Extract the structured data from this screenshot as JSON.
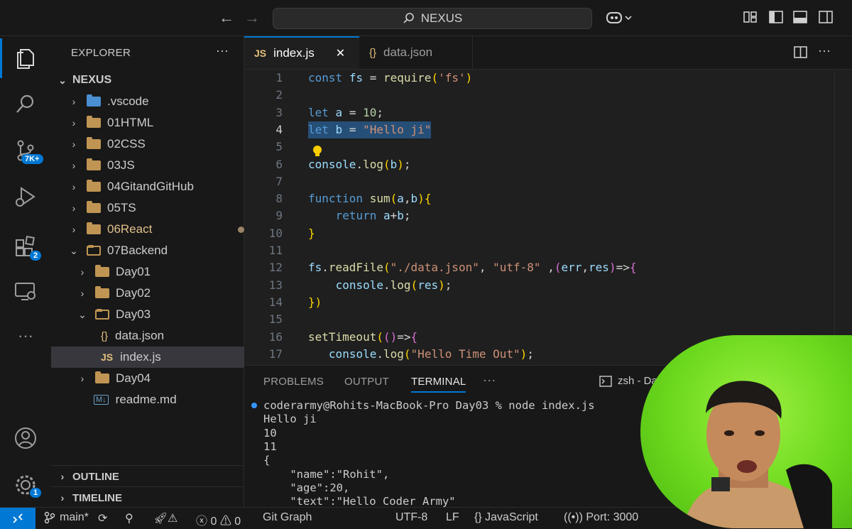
{
  "titlebar": {
    "search_label": "NEXUS",
    "icons": [
      "back-arrow-icon",
      "forward-arrow-icon",
      "search-icon",
      "copilot-icon",
      "customize-layout-icon",
      "toggle-sidebar-icon",
      "toggle-panel-icon",
      "toggle-secondary-sidebar-icon"
    ]
  },
  "activitybar": {
    "items": [
      "explorer-icon",
      "search-icon",
      "source-control-icon",
      "run-debug-icon",
      "extensions-icon",
      "remote-explorer-icon",
      "more-icon",
      "accounts-icon",
      "manage-gear-icon"
    ],
    "source_control_badge": "7K+",
    "extensions_badge": "2",
    "manage_badge": "1"
  },
  "sidebar": {
    "title": "EXPLORER",
    "more": "···",
    "root": "NEXUS",
    "tree": [
      {
        "label": ".vscode"
      },
      {
        "label": "01HTML"
      },
      {
        "label": "02CSS"
      },
      {
        "label": "03JS"
      },
      {
        "label": "04GitandGitHub"
      },
      {
        "label": "05TS"
      },
      {
        "label": "06React"
      },
      {
        "label": "07Backend"
      },
      {
        "label": "Day01"
      },
      {
        "label": "Day02"
      },
      {
        "label": "Day03"
      },
      {
        "label": "data.json"
      },
      {
        "label": "index.js"
      },
      {
        "label": "Day04"
      },
      {
        "label": "readme.md"
      }
    ],
    "outline": "OUTLINE",
    "timeline": "TIMELINE"
  },
  "editor": {
    "tabs": [
      {
        "icon_text": "JS",
        "label": "index.js",
        "close": "✕"
      },
      {
        "icon_text": "{}",
        "label": "data.json"
      }
    ],
    "line_numbers": [
      "1",
      "2",
      "3",
      "4",
      "5",
      "6",
      "7",
      "8",
      "9",
      "10",
      "11",
      "12",
      "13",
      "14",
      "15",
      "16",
      "17"
    ],
    "current_line": 4,
    "lines": [
      "const fs = require('fs')",
      "",
      "let a = 10;",
      "let b = \"Hello ji\"",
      "",
      "console.log(b);",
      "",
      "function sum(a,b){",
      "    return a+b;",
      "}",
      "",
      "fs.readFile(\"./data.json\", \"utf-8\" ,(err,res)=>{",
      "    console.log(res);",
      "})",
      "",
      "setTimeout(()=>{",
      "   console.log(\"Hello Time Out\");"
    ]
  },
  "panel": {
    "tabs": [
      "PROBLEMS",
      "OUTPUT",
      "TERMINAL"
    ],
    "active_tab": "TERMINAL",
    "more": "···",
    "terminal_name": "zsh - Day",
    "terminal_lines": [
      "coderarmy@Rohits-MacBook-Pro Day03 % node index.js",
      "Hello ji",
      "10",
      "11",
      "{",
      "    \"name\":\"Rohit\",",
      "    \"age\":20,",
      "    \"text\":\"Hello Coder Army\""
    ]
  },
  "statusbar": {
    "branch": "main*",
    "errors": "0",
    "warnings": "0",
    "git_graph": "Git Graph",
    "encoding": "UTF-8",
    "eol": "LF",
    "language": "JavaScript",
    "port": "Port: 3000"
  },
  "colors": {
    "accent": "#0078d4",
    "background": "#1f1f1f",
    "sidebar": "#181818",
    "folder": "#c09553",
    "webcam_green": "#7be02c"
  }
}
